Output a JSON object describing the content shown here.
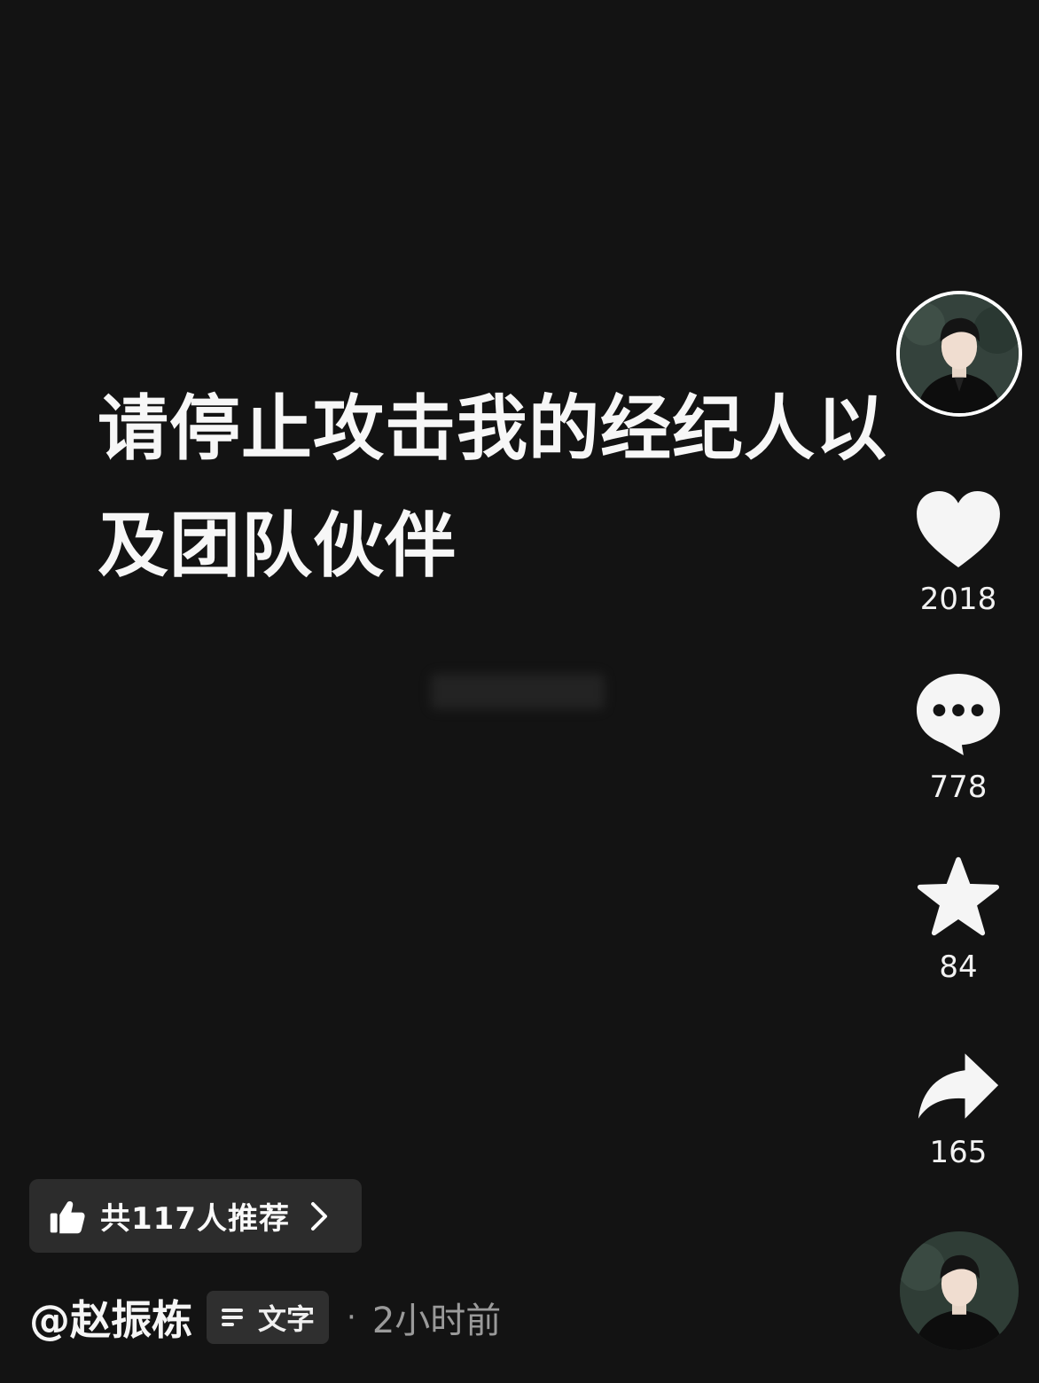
{
  "post": {
    "text": "请停止攻击我的经纪人以及团队伙伴"
  },
  "actions": {
    "like_count": "2018",
    "comment_count": "778",
    "favorite_count": "84",
    "share_count": "165"
  },
  "recommend": {
    "label": "共117人推荐"
  },
  "meta": {
    "author": "@赵振栋",
    "type_label": "文字",
    "separator": "·",
    "time": "2小时前"
  },
  "icons": {
    "like": "heart-icon",
    "comment": "comment-bubble-icon",
    "favorite": "star-icon",
    "share": "share-arrow-icon",
    "recommend": "thumbs-up-icon",
    "type": "text-lines-icon",
    "more": "chevron-right-icon"
  },
  "colors": {
    "background": "#131313",
    "icon_fill": "#f5f5f5",
    "pill_bg": "#2c2c2c",
    "muted_text": "#9a9a9a"
  }
}
